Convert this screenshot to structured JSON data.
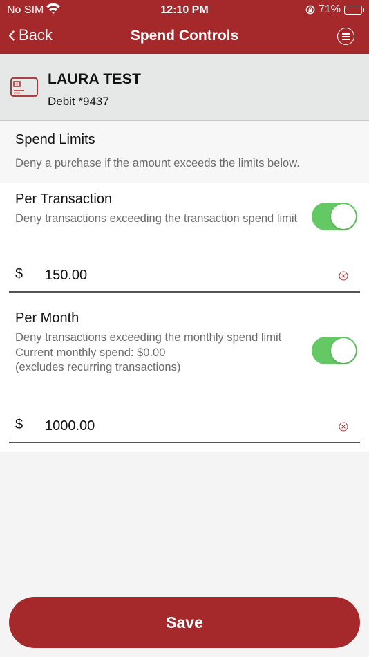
{
  "status_bar": {
    "carrier": "No SIM",
    "time": "12:10 PM",
    "battery": "71%",
    "battery_level": 0.71,
    "icons": [
      "wifi-icon",
      "orientation-lock-icon",
      "battery-icon"
    ]
  },
  "nav": {
    "back_label": "Back",
    "title": "Spend Controls",
    "menu_icon": "menu-icon",
    "bar_color": "#a5282b"
  },
  "card": {
    "name": "LAURA TEST",
    "subtitle": "Debit *9437",
    "icon": "credit-card-icon"
  },
  "spend_limits": {
    "title": "Spend Limits",
    "description": "Deny a purchase if the amount exceeds the limits below.",
    "per_transaction": {
      "title": "Per Transaction",
      "description": "Deny transactions exceeding the transaction spend limit",
      "enabled": true,
      "currency": "$",
      "value": "150.00"
    },
    "per_month": {
      "title": "Per Month",
      "description": "Deny transactions exceeding the monthly spend limit",
      "current_spend": "Current monthly spend: $0.00",
      "note": "(excludes recurring transactions)",
      "enabled": true,
      "currency": "$",
      "value": "1000.00"
    }
  },
  "save_label": "Save",
  "colors": {
    "accent": "#a5282b",
    "toggle_on": "#64c964",
    "muted_text": "#6b6b6b",
    "card_panel_bg": "#e6e7e7"
  }
}
